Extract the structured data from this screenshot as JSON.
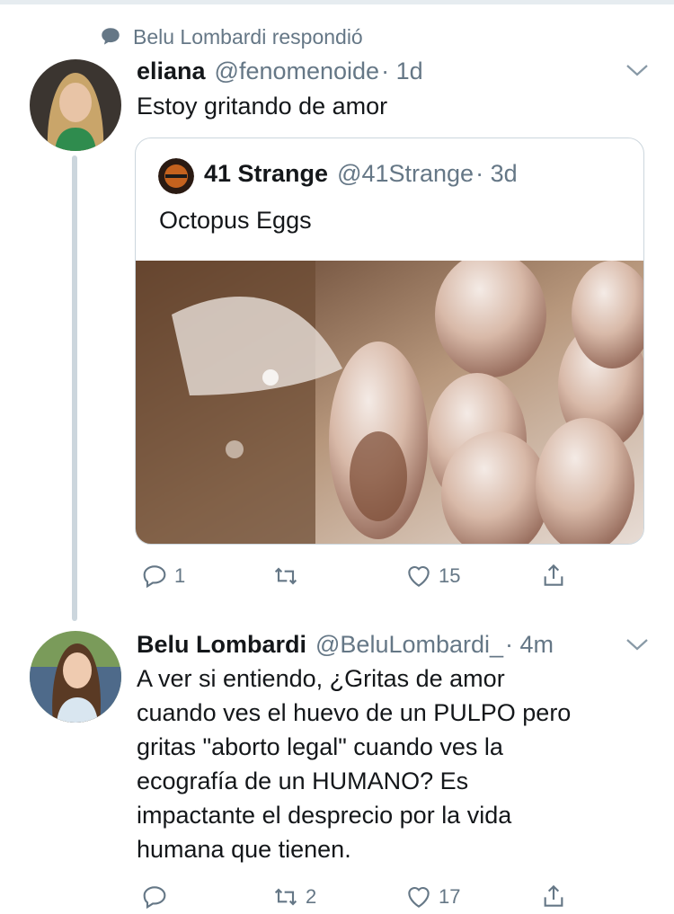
{
  "context": {
    "text": "Belu Lombardi respondió"
  },
  "tweet1": {
    "name": "eliana",
    "handle": "@fenomenoide",
    "time": "· 1d",
    "text": "Estoy gritando de amor",
    "quote": {
      "name": "41 Strange",
      "handle": "@41Strange",
      "time": "· 3d",
      "text": "Octopus Eggs"
    },
    "actions": {
      "replies": "1",
      "retweets": "",
      "likes": "15"
    }
  },
  "tweet2": {
    "name": "Belu Lombardi",
    "handle": "@BeluLombardi_",
    "time": "· 4m",
    "text_lines": [
      "A ver si entiendo, ¿Gritas de amor",
      "cuando ves el huevo de un PULPO pero",
      "gritas \"aborto legal\" cuando ves la",
      "ecografía de un HUMANO? Es",
      "impactante el desprecio por la vida",
      "humana que tienen."
    ],
    "actions": {
      "replies": "",
      "retweets": "2",
      "likes": "17"
    }
  },
  "colors": {
    "muted": "#657786",
    "border": "#ccd6dd",
    "text": "#14171a"
  },
  "icons": [
    "speech-bubble-icon",
    "chevron-down-icon",
    "reply-icon",
    "retweet-icon",
    "heart-icon",
    "share-icon"
  ]
}
